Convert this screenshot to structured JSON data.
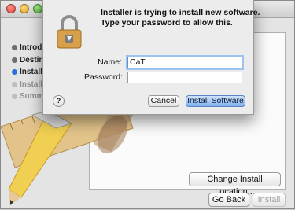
{
  "installer": {
    "steps": [
      {
        "label": "Introduc",
        "state": "done"
      },
      {
        "label": "Destina",
        "state": "done"
      },
      {
        "label": "Installa",
        "state": "current"
      },
      {
        "label": "Installat",
        "state": "future"
      },
      {
        "label": "Summa",
        "state": "future"
      }
    ],
    "change_location_label": "Change Install Location...",
    "go_back_label": "Go Back",
    "install_label": "Install"
  },
  "auth_dialog": {
    "message_line1": "Installer is trying to install new software.",
    "message_line2": "Type your password to allow this.",
    "name_label": "Name:",
    "name_value": "CaT",
    "password_label": "Password:",
    "password_value": "",
    "help_label": "?",
    "cancel_label": "Cancel",
    "confirm_label": "Install Software"
  }
}
